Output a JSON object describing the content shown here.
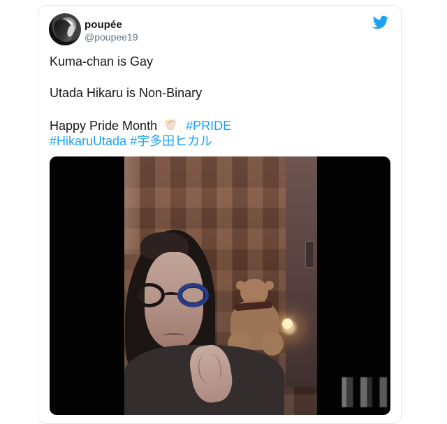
{
  "tweet": {
    "author": {
      "display_name": "poupée",
      "handle": "@poupee19",
      "avatar_icon": "profile-avatar"
    },
    "platform_icon": "twitter-bird-icon",
    "text": {
      "line1": "Kuma-chan is Gay",
      "line2": "Utada Hikaru is Non-Binary",
      "line3_prefix": "Happy Pride Month",
      "line3_emoji_icon": "clapping-hands-icon",
      "line3_hashtag": "#PRIDE",
      "line4_hashtag1": "#HikaruUtada",
      "line4_hashtag2": "#宇多田ヒカル"
    },
    "colors": {
      "hashtag": "#1da1f2",
      "twitter_blue": "#1da1f2",
      "text": "#14171a",
      "handle": "#657786"
    }
  }
}
